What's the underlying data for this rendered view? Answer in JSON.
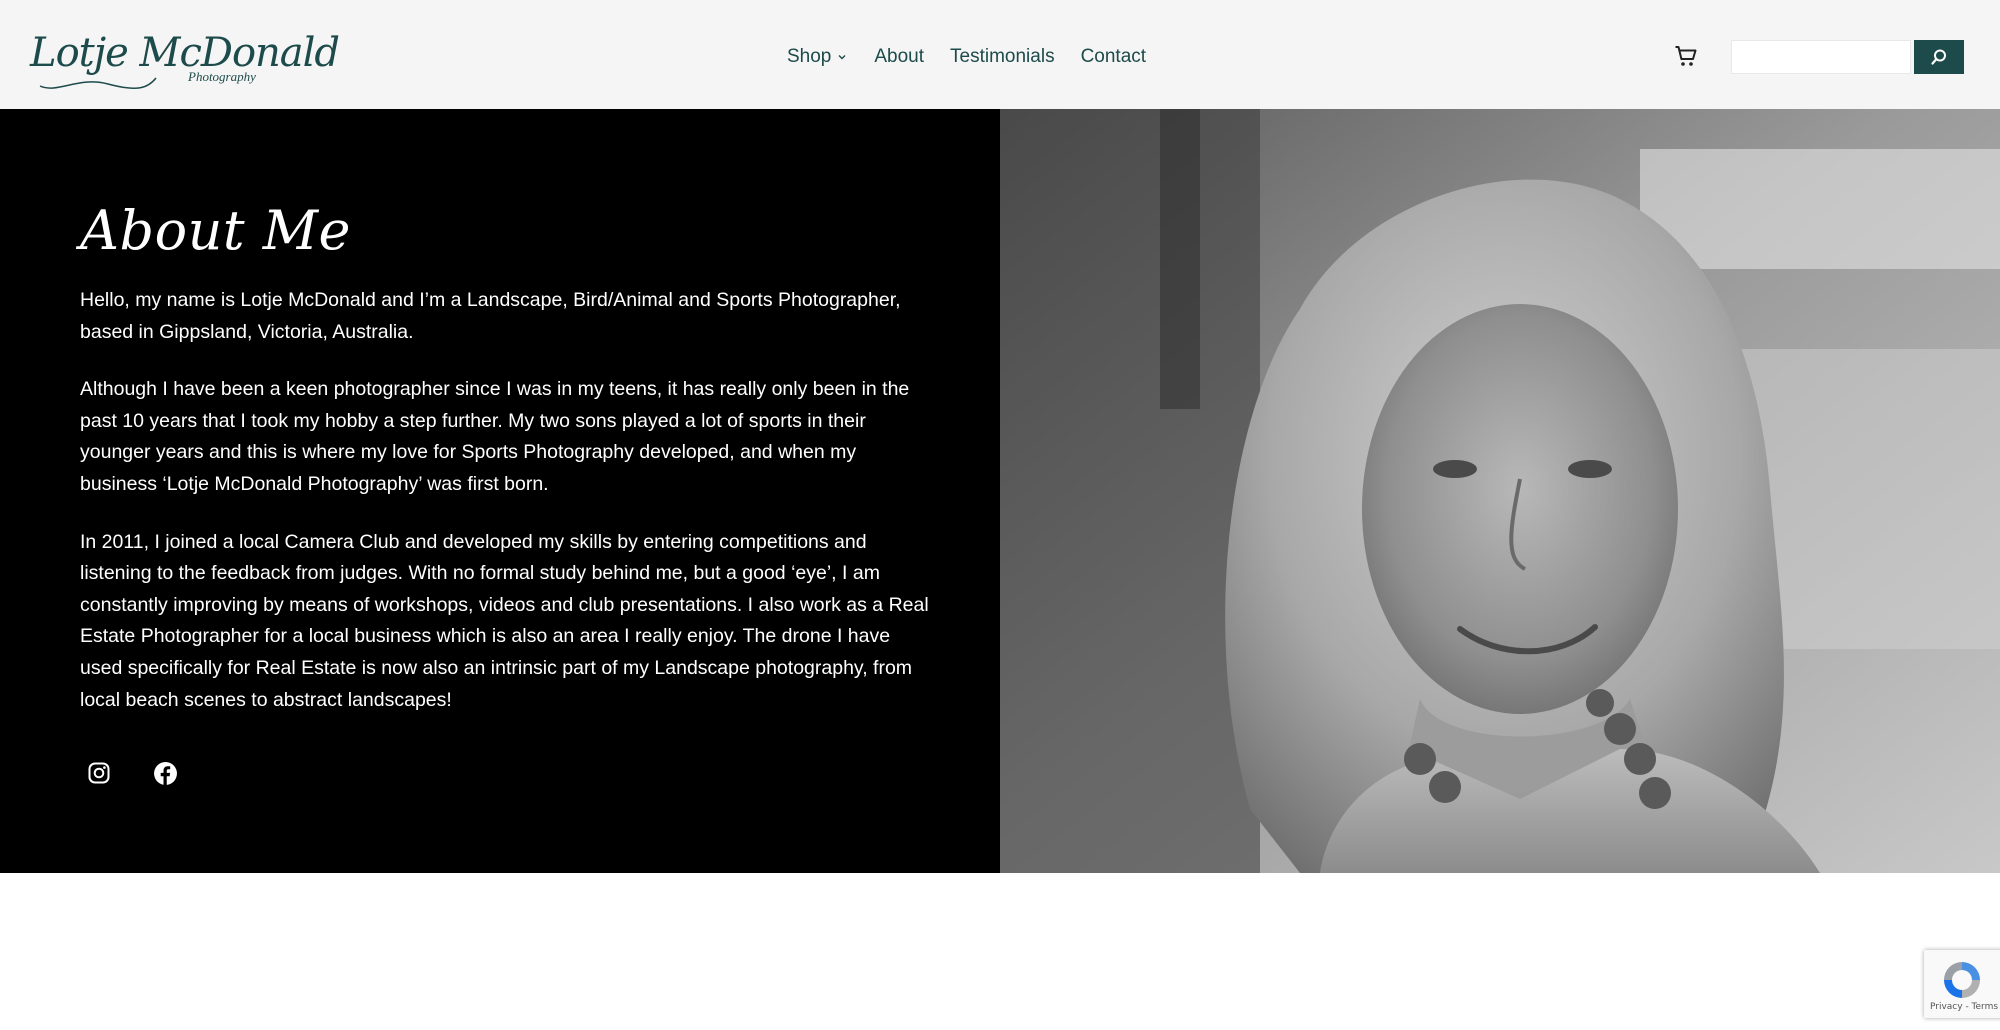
{
  "brand": {
    "logo_name": "Lotje McDonald",
    "logo_tagline": "Photography",
    "primary_color": "#1d4a4a"
  },
  "nav": {
    "items": [
      {
        "label": "Shop",
        "has_dropdown": true
      },
      {
        "label": "About"
      },
      {
        "label": "Testimonials"
      },
      {
        "label": "Contact"
      }
    ]
  },
  "header_actions": {
    "cart_icon": "cart-icon",
    "search_value": "",
    "search_icon": "search-icon"
  },
  "hero": {
    "heading": "About Me",
    "paragraphs": [
      "Hello, my name is Lotje McDonald and I’m a Landscape, Bird/Animal and Sports Photographer, based in Gippsland, Victoria, Australia.",
      "Although I have been a keen photographer since I was in my teens, it has really only been in the past 10 years that I took my hobby a step further. My two sons played a lot of sports in their younger years and this is where my love for Sports Photography developed, and when my business ‘Lotje McDonald Photography’ was first born.",
      "In 2011, I joined a local Camera Club and developed my skills by entering competitions and listening to the feedback from judges. With no formal study behind me, but a good ‘eye’, I am constantly improving by means of workshops, videos and club presentations. I also work as a Real Estate Photographer for a local business which is also an area I really enjoy. The drone I have used specifically for Real Estate is now also an intrinsic part of my Landscape photography, from local beach scenes to abstract landscapes!"
    ],
    "social": [
      {
        "icon": "instagram-icon"
      },
      {
        "icon": "facebook-icon"
      }
    ],
    "background_color": "#000000"
  },
  "recaptcha": {
    "text": "Privacy - Terms"
  }
}
